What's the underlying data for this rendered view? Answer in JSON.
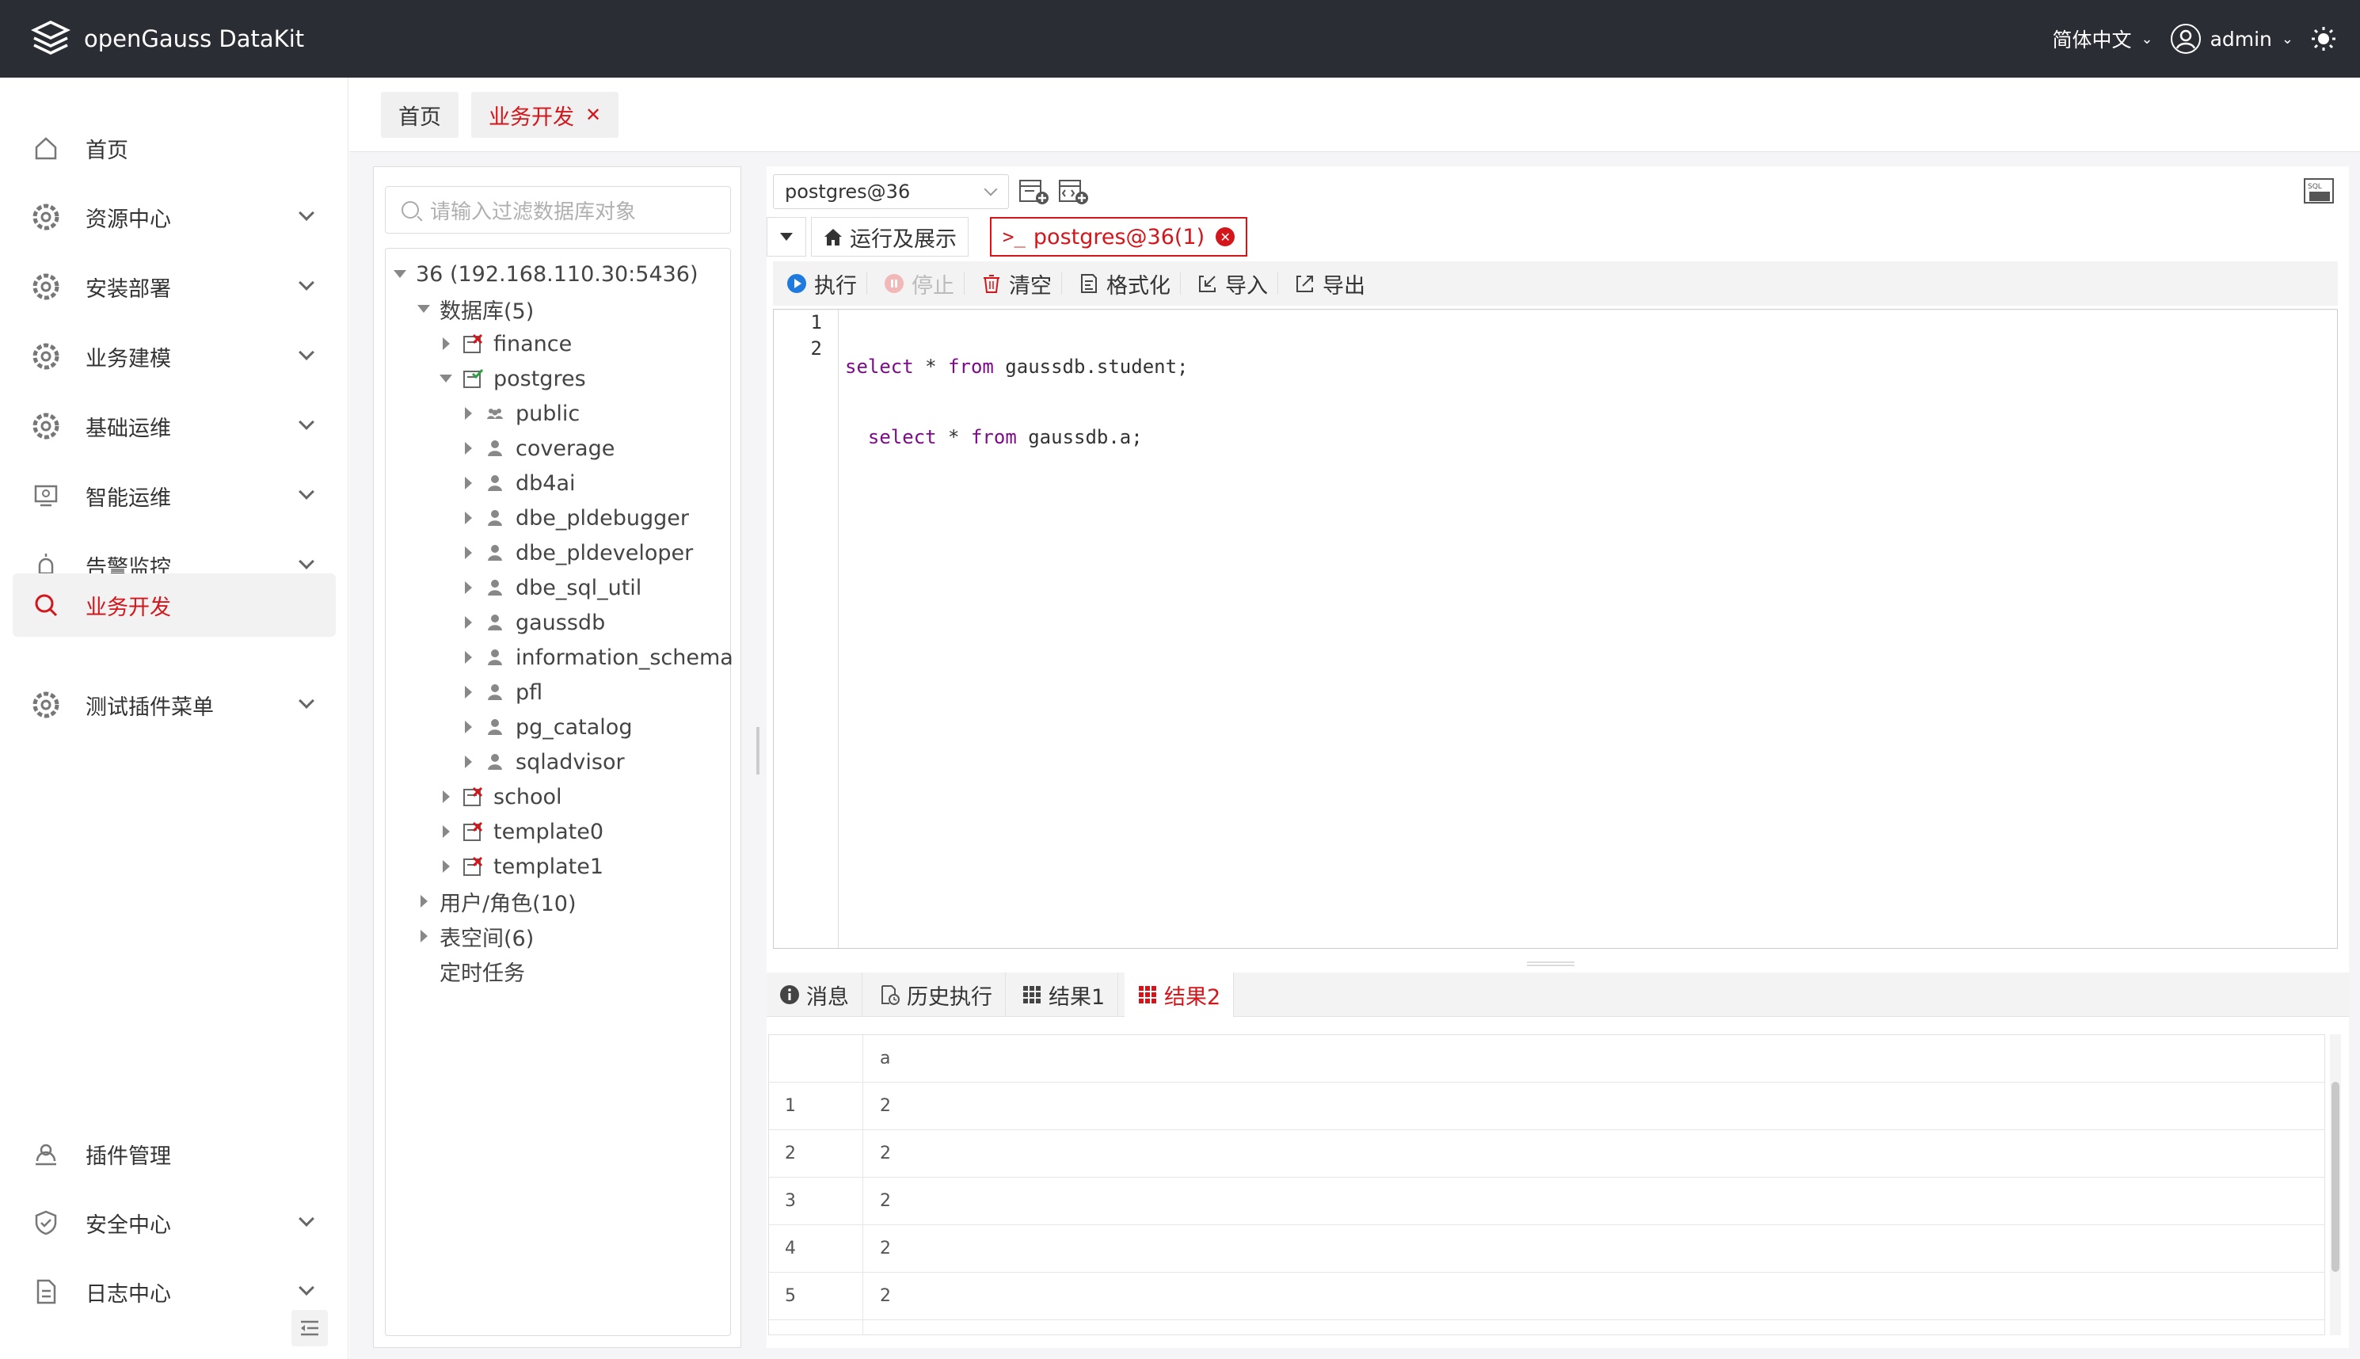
{
  "app": {
    "title": "openGauss DataKit"
  },
  "topbar": {
    "language": "简体中文",
    "user": "admin"
  },
  "sidebar": {
    "items": [
      {
        "label": "首页",
        "icon": "home-icon",
        "expandable": false
      },
      {
        "label": "资源中心",
        "icon": "gear-icon",
        "expandable": true
      },
      {
        "label": "安装部署",
        "icon": "gear-icon",
        "expandable": true
      },
      {
        "label": "业务建模",
        "icon": "gear-icon",
        "expandable": true
      },
      {
        "label": "基础运维",
        "icon": "gear-icon",
        "expandable": true
      },
      {
        "label": "智能运维",
        "icon": "monitor-icon",
        "expandable": true
      },
      {
        "label": "告警监控",
        "icon": "alarm-icon",
        "expandable": true
      },
      {
        "label": "业务开发",
        "icon": "search-icon",
        "expandable": false,
        "active": true
      },
      {
        "label": "测试插件菜单",
        "icon": "gear-icon",
        "expandable": true
      }
    ],
    "bottom_items": [
      {
        "label": "插件管理",
        "icon": "plugin-icon",
        "expandable": false
      },
      {
        "label": "安全中心",
        "icon": "shield-icon",
        "expandable": true
      },
      {
        "label": "日志中心",
        "icon": "document-icon",
        "expandable": true
      }
    ]
  },
  "page_tabs": [
    {
      "label": "首页",
      "active": false
    },
    {
      "label": "业务开发",
      "active": true,
      "closable": true
    }
  ],
  "tree": {
    "filter_placeholder": "请输入过滤数据库对象",
    "nodes": [
      {
        "label": "36 (192.168.110.30:5436)"
      },
      {
        "label": "数据库(5)"
      },
      {
        "label": "finance"
      },
      {
        "label": "postgres"
      },
      {
        "label": "public"
      },
      {
        "label": "coverage"
      },
      {
        "label": "db4ai"
      },
      {
        "label": "dbe_pldebugger"
      },
      {
        "label": "dbe_pldeveloper"
      },
      {
        "label": "dbe_sql_util"
      },
      {
        "label": "gaussdb"
      },
      {
        "label": "information_schema"
      },
      {
        "label": "pfl"
      },
      {
        "label": "pg_catalog"
      },
      {
        "label": "sqladvisor"
      },
      {
        "label": "school"
      },
      {
        "label": "template0"
      },
      {
        "label": "template1"
      },
      {
        "label": "用户/角色(10)"
      },
      {
        "label": "表空间(6)"
      },
      {
        "label": "定时任务"
      }
    ]
  },
  "editor": {
    "connection": "postgres@36",
    "run_tab": "运行及展示",
    "session_tab": "postgres@36(1)",
    "toolbar": {
      "execute": "执行",
      "stop": "停止",
      "clear": "清空",
      "format": "格式化",
      "import": "导入",
      "export": "导出"
    },
    "lines": [
      {
        "num": "1",
        "indent": "",
        "kw1": "select",
        "mid": " * ",
        "kw2": "from",
        "rest": " gaussdb.student;"
      },
      {
        "num": "2",
        "indent": "  ",
        "kw1": "select",
        "mid": " * ",
        "kw2": "from",
        "rest": " gaussdb.a;"
      }
    ]
  },
  "results": {
    "tabs": [
      "消息",
      "历史执行",
      "结果1",
      "结果2"
    ],
    "active_tab": "结果2",
    "columns": [
      "",
      "a"
    ],
    "rows": [
      [
        "1",
        "2"
      ],
      [
        "2",
        "2"
      ],
      [
        "3",
        "2"
      ],
      [
        "4",
        "2"
      ],
      [
        "5",
        "2"
      ]
    ]
  },
  "colors": {
    "accent": "#d4161b",
    "topbar": "#2b2d35"
  }
}
